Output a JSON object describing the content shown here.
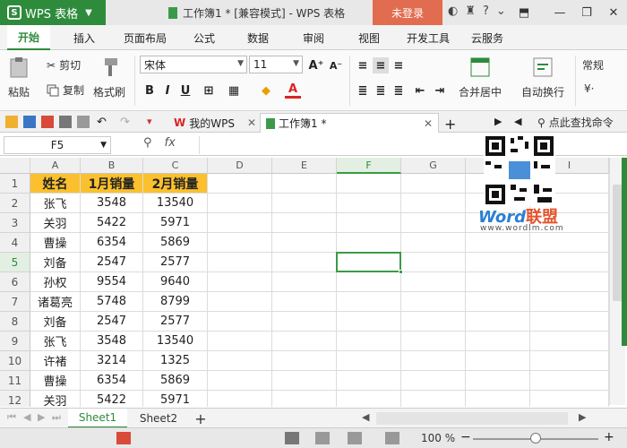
{
  "app": {
    "name": "WPS 表格",
    "window_title": "工作簿1 * [兼容模式] - WPS 表格",
    "login_label": "未登录"
  },
  "menu": {
    "tabs": [
      "开始",
      "插入",
      "页面布局",
      "公式",
      "数据",
      "审阅",
      "视图",
      "开发工具",
      "云服务"
    ]
  },
  "ribbon": {
    "paste": "粘贴",
    "cut": "剪切",
    "copy": "复制",
    "format_painter": "格式刷",
    "font_name": "宋体",
    "font_size": "11",
    "merge_center": "合并居中",
    "wrap_text": "自动换行",
    "style": "常规"
  },
  "doc_tabs": [
    {
      "label": "我的WPS"
    },
    {
      "label": "工作簿1 *"
    }
  ],
  "search_label": "点此查找命令",
  "formula": {
    "cell_ref": "F5",
    "fx": "fx",
    "content": ""
  },
  "sheet": {
    "columns": [
      "A",
      "B",
      "C",
      "D",
      "E",
      "F",
      "G",
      "H",
      "I"
    ],
    "rows": [
      "1",
      "2",
      "3",
      "4",
      "5",
      "6",
      "7",
      "8",
      "9",
      "10",
      "11",
      "12"
    ],
    "selected_cell": "F5",
    "data": [
      [
        "姓名",
        "1月销量",
        "2月销量"
      ],
      [
        "张飞",
        "3548",
        "13540"
      ],
      [
        "关羽",
        "5422",
        "5971"
      ],
      [
        "曹操",
        "6354",
        "5869"
      ],
      [
        "刘备",
        "2547",
        "2577"
      ],
      [
        "孙权",
        "9554",
        "9640"
      ],
      [
        "诸葛亮",
        "5748",
        "8799"
      ],
      [
        "刘备",
        "2547",
        "2577"
      ],
      [
        "张飞",
        "3548",
        "13540"
      ],
      [
        "许褚",
        "3214",
        "1325"
      ],
      [
        "曹操",
        "6354",
        "5869"
      ],
      [
        "关羽",
        "5422",
        "5971"
      ]
    ]
  },
  "watermark": {
    "word": "Word",
    "cn": "联盟",
    "url": "www.wordlm.com"
  },
  "sheet_tabs": [
    {
      "label": "Sheet1"
    },
    {
      "label": "Sheet2"
    }
  ],
  "status": {
    "zoom": "100 %"
  },
  "colors": {
    "brand": "#2e8b3c",
    "login": "#e26c4f",
    "header_fill": "#fbc02d"
  }
}
